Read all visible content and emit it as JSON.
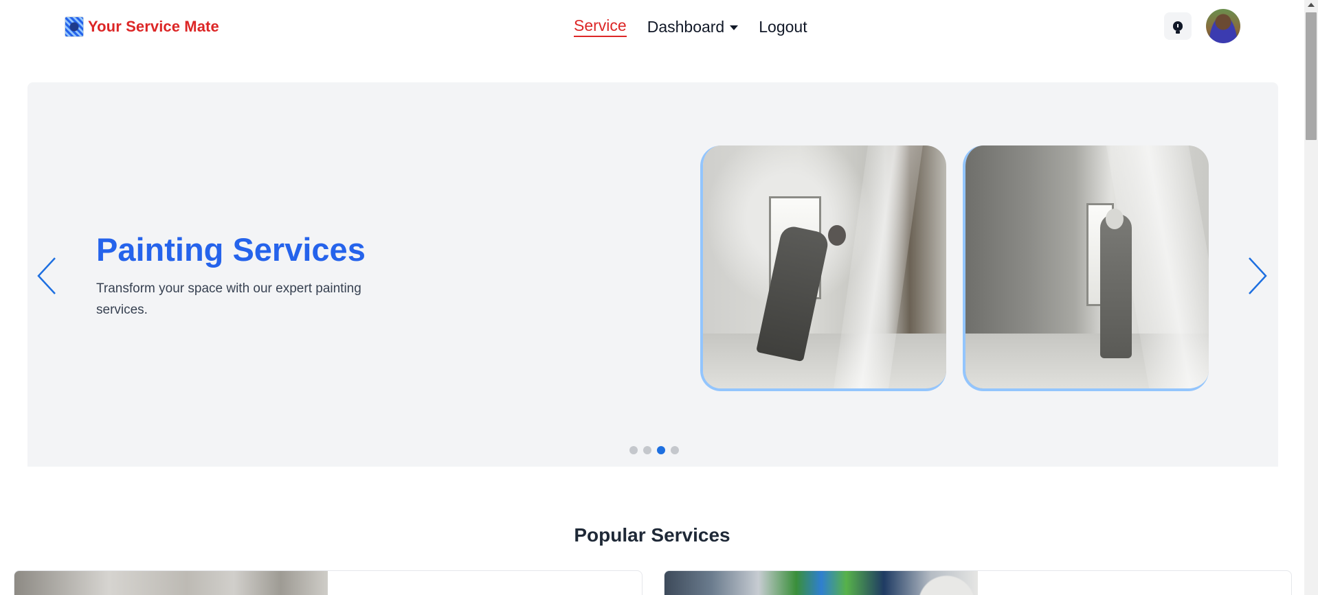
{
  "brand": {
    "name": "Your Service Mate",
    "logo_icon": "brand-logo-icon"
  },
  "nav": {
    "links": [
      {
        "label": "Service",
        "active": true
      },
      {
        "label": "Dashboard",
        "has_dropdown": true
      },
      {
        "label": "Logout"
      }
    ],
    "theme_toggle_icon": "lightbulb-icon"
  },
  "colors": {
    "brand_red": "#dc2626",
    "hero_blue": "#2563eb",
    "hero_bg": "#f3f4f6",
    "dot_active": "#1d6fe0",
    "slide_border": "#93c5fd"
  },
  "hero": {
    "title": "Painting Services",
    "description": "Transform your space with our expert painting services.",
    "slides": [
      {
        "icon": "painter-spraying-photo"
      },
      {
        "icon": "painter-spraying-wall-photo"
      }
    ],
    "dots": {
      "count": 4,
      "active_index": 2
    }
  },
  "popular": {
    "title": "Popular Services"
  }
}
